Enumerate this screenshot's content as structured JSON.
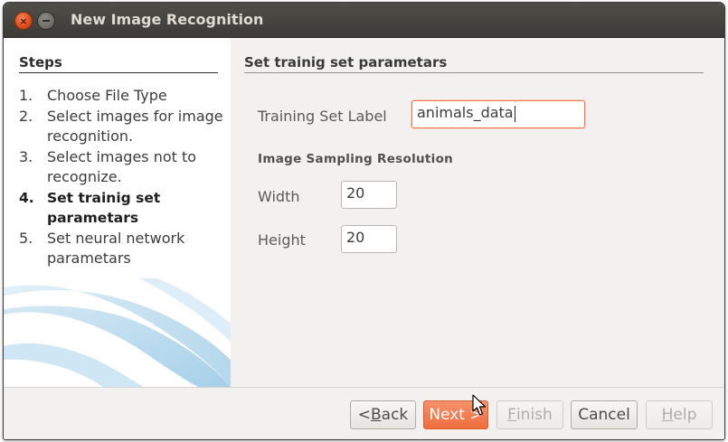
{
  "window": {
    "title": "New Image Recognition",
    "close_glyph": "×"
  },
  "steps": {
    "heading": "Steps",
    "items": [
      {
        "num": "1.",
        "label": "Choose File Type",
        "active": false
      },
      {
        "num": "2.",
        "label": "Select images for image recognition.",
        "active": false
      },
      {
        "num": "3.",
        "label": "Select images not to recognize.",
        "active": false
      },
      {
        "num": "4.",
        "label": "Set trainig set parametars",
        "active": true
      },
      {
        "num": "5.",
        "label": "Set neural network parametars",
        "active": false
      }
    ]
  },
  "content": {
    "heading": "Set trainig set parametars",
    "training_set_label": "Training Set Label",
    "training_set_value": "animals_data",
    "sampling_heading": "Image Sampling Resolution",
    "width_label": "Width",
    "width_value": "20",
    "height_label": "Height",
    "height_value": "20"
  },
  "buttons": {
    "back": {
      "mnemonic": "B",
      "rest": "ack",
      "prefix": "< ",
      "enabled": true
    },
    "next": {
      "label": "Next >",
      "enabled": true
    },
    "finish": {
      "mnemonic": "F",
      "rest": "inish",
      "enabled": false
    },
    "cancel": {
      "label": "Cancel",
      "enabled": true
    },
    "help": {
      "mnemonic": "H",
      "rest": "elp",
      "enabled": false
    }
  },
  "colors": {
    "accent": "#f07746",
    "titlebar": "#3c3b37",
    "window_bg": "#f2f1f0"
  },
  "icons": [
    "close-icon",
    "minimize-icon",
    "mouse-cursor-icon"
  ]
}
